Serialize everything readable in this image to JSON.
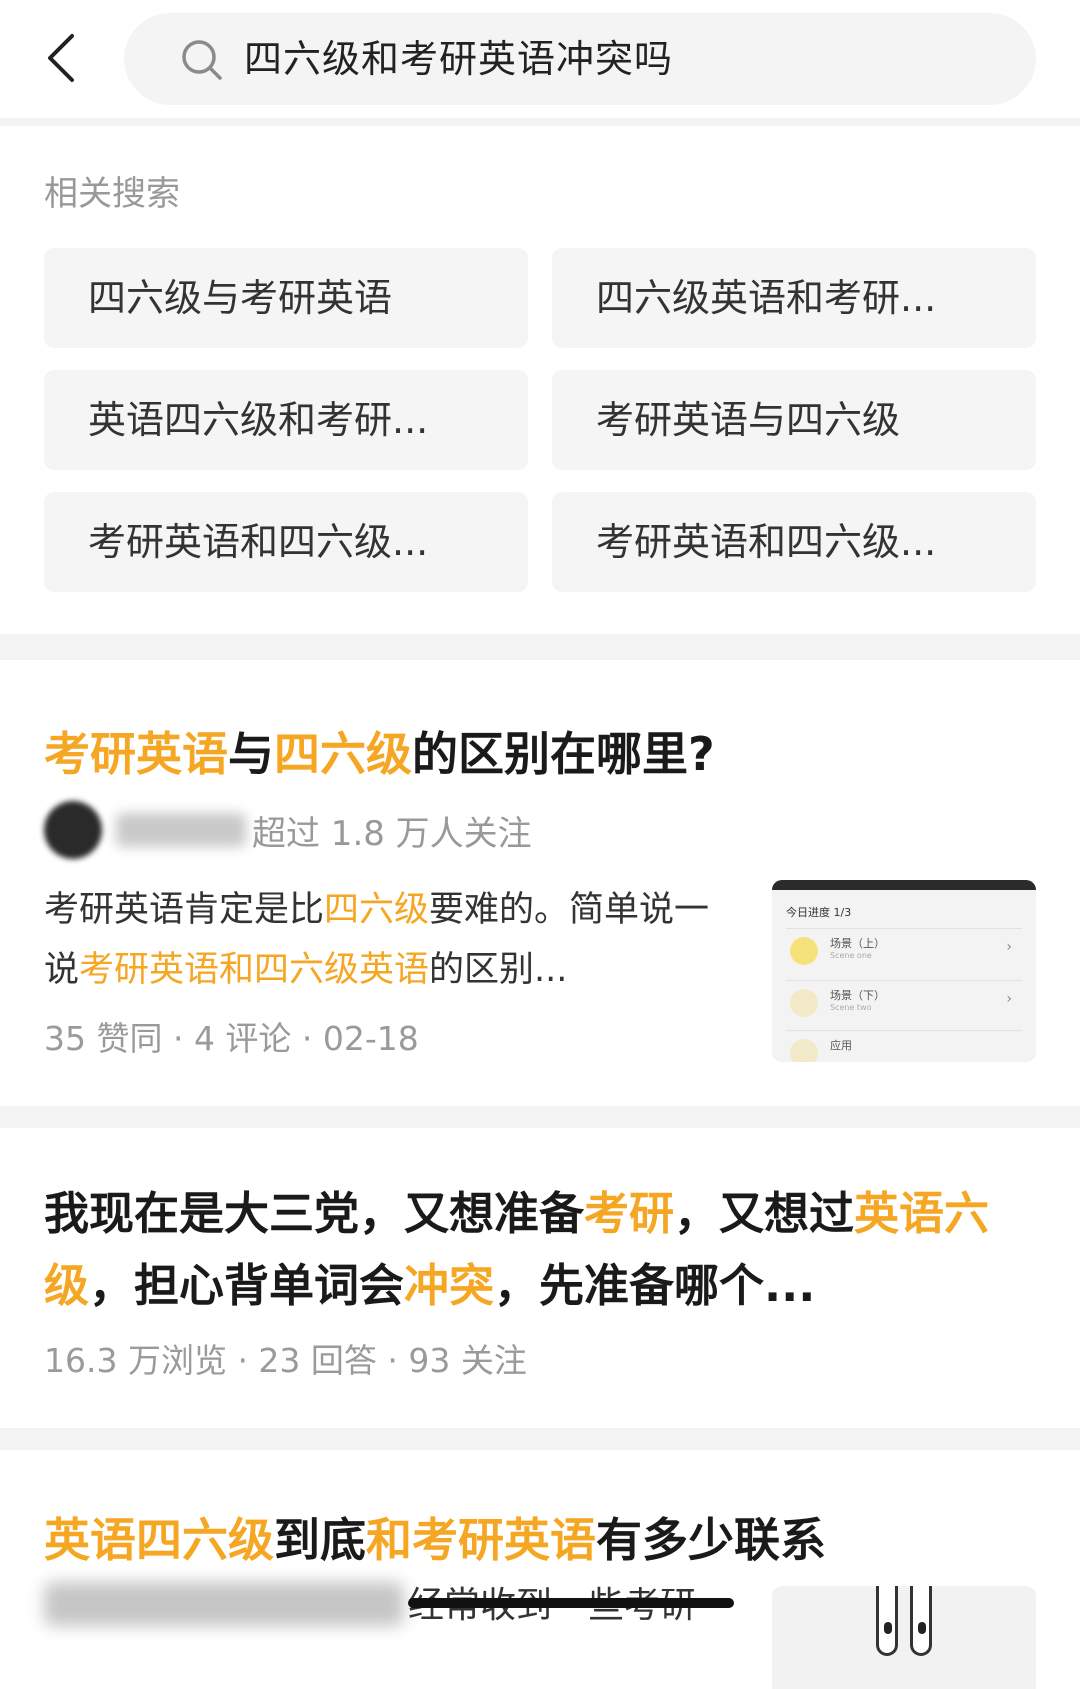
{
  "search": {
    "query": "四六级和考研英语冲突吗"
  },
  "related": {
    "title": "相关搜索",
    "items": [
      "四六级与考研英语",
      "四六级英语和考研...",
      "英语四六级和考研...",
      "考研英语与四六级",
      "考研英语和四六级...",
      "考研英语和四六级..."
    ]
  },
  "results": [
    {
      "title_parts": [
        {
          "text": "考研英语",
          "highlight": true
        },
        {
          "text": "与",
          "highlight": false
        },
        {
          "text": "四六级",
          "highlight": true
        },
        {
          "text": "的区别在哪里?",
          "highlight": false
        }
      ],
      "author_follow": "超过 1.8 万人关注",
      "excerpt_parts": [
        {
          "text": "考研英语肯定是比",
          "highlight": false
        },
        {
          "text": "四六级",
          "highlight": true
        },
        {
          "text": "要难的。简单说一说",
          "highlight": false
        },
        {
          "text": "考研英语和四六级英语",
          "highlight": true
        },
        {
          "text": "的区别...",
          "highlight": false
        }
      ],
      "meta": "35 赞同 · 4 评论 · 02-18",
      "thumbnail": {
        "header": "今日进度  1/3",
        "rows": [
          {
            "label": "场景（上）",
            "sub": "Scene one"
          },
          {
            "label": "场景（下）",
            "sub": "Scene two"
          },
          {
            "label": "应用",
            "sub": ""
          }
        ]
      }
    },
    {
      "title_parts": [
        {
          "text": "我现在是大三党，又想准备",
          "highlight": false
        },
        {
          "text": "考研",
          "highlight": true
        },
        {
          "text": "，又想过",
          "highlight": false
        },
        {
          "text": "英语六级",
          "highlight": true
        },
        {
          "text": "，担心背单词会",
          "highlight": false
        },
        {
          "text": "冲突",
          "highlight": true
        },
        {
          "text": "，先准备哪个...",
          "highlight": false
        }
      ],
      "meta": "16.3 万浏览 · 23 回答 · 93 关注"
    },
    {
      "title_parts": [
        {
          "text": "英语四六级",
          "highlight": true
        },
        {
          "text": "到底",
          "highlight": false
        },
        {
          "text": "和考研英语",
          "highlight": true
        },
        {
          "text": "有多少联系",
          "highlight": false
        }
      ],
      "snippet": "经常收到一些考研"
    }
  ],
  "colors": {
    "highlight": "#f5a623",
    "background": "#f3f3f3",
    "card": "#ffffff"
  }
}
